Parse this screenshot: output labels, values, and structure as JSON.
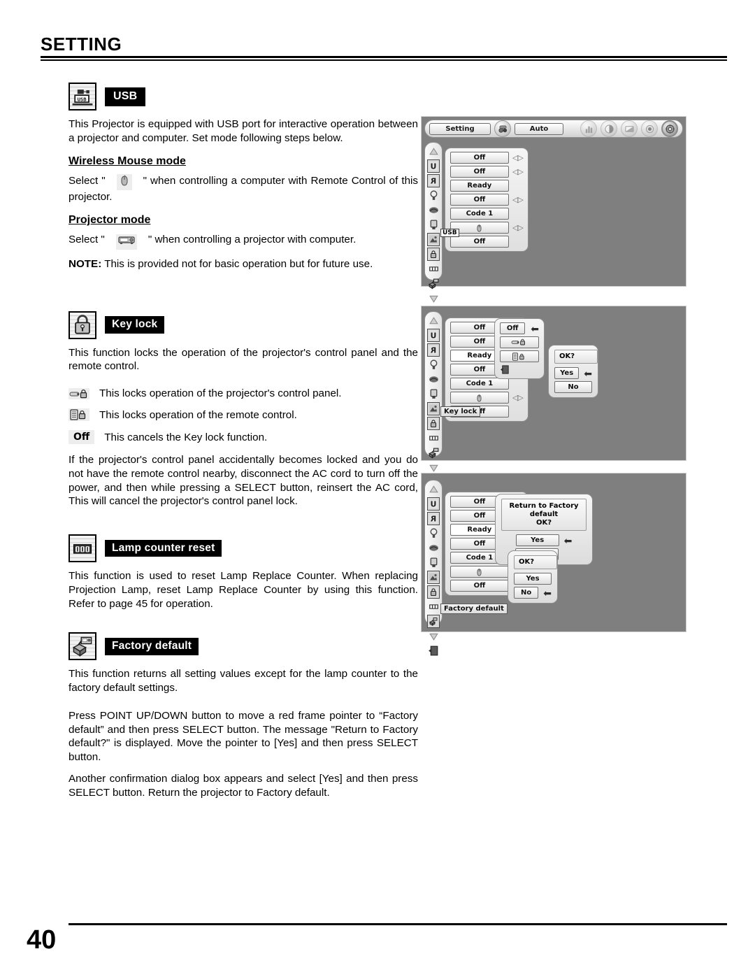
{
  "page": {
    "title": "SETTING",
    "number": "40"
  },
  "sections": {
    "usb": {
      "icon": "usb-port-icon",
      "tag": "USB",
      "intro": "This Projector is equipped with USB port for interactive operation between a projector and computer. Set mode following steps below.",
      "wireless": {
        "heading": "Wireless Mouse mode",
        "text_before": "Select \"",
        "icon": "mouse-icon",
        "text_after": "\" when controlling a computer with Remote Control of this projector."
      },
      "projector": {
        "heading": "Projector mode",
        "text_before": "Select \"",
        "icon": "projector-icon",
        "text_after": "\" when controlling a projector with computer."
      },
      "note_label": "NOTE:",
      "note_text": " This is provided not for basic operation but for future use."
    },
    "keylock": {
      "icon": "padlock-icon",
      "tag": "Key lock",
      "intro": "This function locks the operation of the projector's control panel and the remote control.",
      "bullets": [
        {
          "icon": "panel-lock-icon",
          "text": "This locks operation of the projector's control panel."
        },
        {
          "icon": "remote-lock-icon",
          "text": "This locks operation of the remote control."
        },
        {
          "icon": "off-text",
          "label": "Off",
          "text": "This cancels the Key lock function."
        }
      ],
      "outro": "If the projector's control panel accidentally becomes locked and you do not have the remote control nearby, disconnect the AC cord to turn off the power, and then while pressing a SELECT button, reinsert the AC cord, This will cancel the projector's control panel lock."
    },
    "lamp_counter": {
      "icon": "lamp-counter-icon",
      "tag": "Lamp counter reset",
      "text": "This function is used to reset Lamp Replace Counter.  When replacing Projection Lamp, reset Lamp Replace Counter by using this function.  Refer to page 45 for operation."
    },
    "factory_default": {
      "icon": "factory-default-icon",
      "tag": "Factory default",
      "text1": "This function returns all setting values except for the lamp counter to the factory default settings.",
      "text2": "Press POINT UP/DOWN button to move a red frame pointer to “Factory default” and then press SELECT button.  The message \"Return to Factory default?\" is displayed.  Move the pointer to [Yes] and then press SELECT button.",
      "text3": "Another confirmation dialog box appears and select [Yes] and then press SELECT button. Return the projector to Factory default."
    }
  },
  "osd_usb": {
    "menubar": {
      "tab_setting": "Setting",
      "icon_setting": "setting-gear-icon",
      "tab_auto": "Auto",
      "icons": [
        "image-level-icon",
        "image-adjust-icon",
        "screen-icon",
        "sound-icon",
        "setting-active-icon"
      ]
    },
    "rail_icons": [
      "scroll-up-icon",
      "language-icon",
      "ceiling-icon",
      "lamp-icon",
      "blue-back-icon",
      "display-icon",
      "logo-icon",
      "keylock-icon",
      "lamp-counter-icon",
      "factory-default-icon",
      "scroll-down-icon",
      "quit-icon"
    ],
    "rows": [
      {
        "value": "Off",
        "adjust": true
      },
      {
        "value": "Off",
        "adjust": true
      },
      {
        "value": "Ready",
        "adjust": false
      },
      {
        "value": "Off",
        "adjust": true
      },
      {
        "value": "Code 1",
        "adjust": false
      },
      {
        "value": "",
        "icon": "mouse-icon",
        "adjust": true
      },
      {
        "value": "Off",
        "adjust": false
      }
    ],
    "tag": "USB"
  },
  "osd_keylock": {
    "rail_icons": [
      "scroll-up-icon",
      "language-icon",
      "ceiling-icon",
      "lamp-icon",
      "blue-back-icon",
      "display-icon",
      "logo-icon",
      "keylock-icon",
      "lamp-counter-icon",
      "factory-default-icon",
      "scroll-down-icon",
      "quit-icon"
    ],
    "rows": [
      {
        "value": "Off",
        "adjust": true
      },
      {
        "value": "Off",
        "adjust": true
      },
      {
        "value": "Ready",
        "adjust": false
      },
      {
        "value": "Off",
        "adjust": true
      },
      {
        "value": "Code 1",
        "adjust": false
      },
      {
        "value": "",
        "icon": "mouse-icon",
        "adjust": true
      },
      {
        "value": "Off",
        "adjust": false
      }
    ],
    "tag": "Key lock",
    "submenu": {
      "items": [
        {
          "value": "Off",
          "pointer": true
        },
        {
          "icon": "panel-lock-icon"
        },
        {
          "icon": "remote-lock-icon"
        }
      ],
      "quit_icon": "quit-icon"
    },
    "dialog": {
      "message": "OK?",
      "yes": "Yes",
      "no": "No",
      "pointer_on": "Yes"
    }
  },
  "osd_factory": {
    "rail_icons": [
      "scroll-up-icon",
      "language-icon",
      "ceiling-icon",
      "lamp-icon",
      "blue-back-icon",
      "display-icon",
      "logo-icon",
      "keylock-icon",
      "lamp-counter-icon",
      "factory-default-icon",
      "scroll-down-icon",
      "quit-icon"
    ],
    "rows": [
      {
        "value": "Off",
        "adjust": true
      },
      {
        "value": "Off",
        "adjust": true
      },
      {
        "value": "Ready",
        "adjust": false
      },
      {
        "value": "Off",
        "adjust": true
      },
      {
        "value": "Code 1",
        "adjust": false
      },
      {
        "value": "",
        "icon": "mouse-icon",
        "adjust": true
      },
      {
        "value": "Off",
        "adjust": false
      }
    ],
    "tag": "Factory default",
    "dialog1": {
      "message": "Return to Factory default\nOK?",
      "yes": "Yes",
      "no": "No",
      "pointer_on": "Yes"
    },
    "dialog2": {
      "message": "OK?",
      "yes": "Yes",
      "no": "No",
      "pointer_on": "No"
    }
  },
  "colors": {
    "osd_background": "#7f7f7f",
    "tag_background": "#000000",
    "tag_text": "#ffffff",
    "page_text": "#000000"
  }
}
